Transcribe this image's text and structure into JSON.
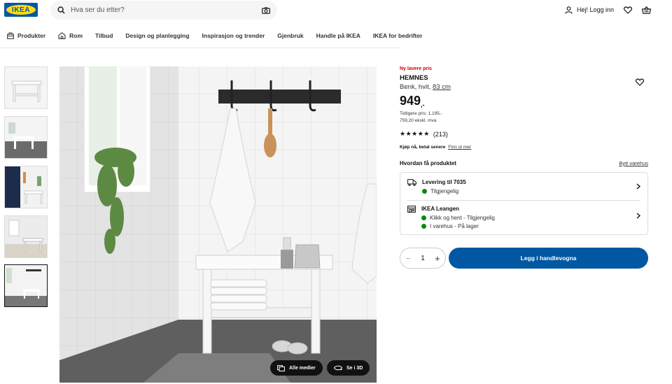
{
  "brand": {
    "logo_text": "IKEA",
    "blue": "#0058a3",
    "yellow": "#ffda1a"
  },
  "search": {
    "placeholder": "Hva ser du etter?"
  },
  "header": {
    "login_label": "Hej! Logg inn"
  },
  "nav": {
    "items": [
      {
        "label": "Produkter",
        "icon": "products-icon"
      },
      {
        "label": "Rom",
        "icon": "home-icon"
      },
      {
        "label": "Tilbud"
      },
      {
        "label": "Design og planlegging"
      },
      {
        "label": "Inspirasjon og trender"
      },
      {
        "label": "Gjenbruk"
      },
      {
        "label": "Handle på IKEA"
      },
      {
        "label": "IKEA for bedrifter"
      }
    ]
  },
  "media": {
    "all_media_label": "Alle medier",
    "view_3d_label": "Se i 3D"
  },
  "product": {
    "badge": "Ny lavere pris",
    "name": "HEMNES",
    "desc_prefix": "Benk, hvit, ",
    "size": "83 cm",
    "price_main": "949",
    "price_suffix": ",-",
    "previous_price": "Tidligere pris: 1.195,-",
    "ex_vat": "759,20 ekskl. mva",
    "rating_stars": "★★★★★",
    "review_count": "(213)",
    "klarna_text": "Kjøp nå, betal senere",
    "klarna_link": "Finn ut mer"
  },
  "fulfilment": {
    "title": "Hvordan få produktet",
    "change_store": "Bytt varehus",
    "delivery_title": "Levering til 7035",
    "delivery_status": "Tilgjengelig",
    "store_title": "IKEA Leangen",
    "store_click": "Klikk og hent - Tilgjengelig",
    "store_instore": "I varehus - På lager",
    "status_color": "#0a8a00"
  },
  "cart": {
    "quantity": "1",
    "minus": "−",
    "plus": "+",
    "add_label": "Legg i handlevogna"
  }
}
